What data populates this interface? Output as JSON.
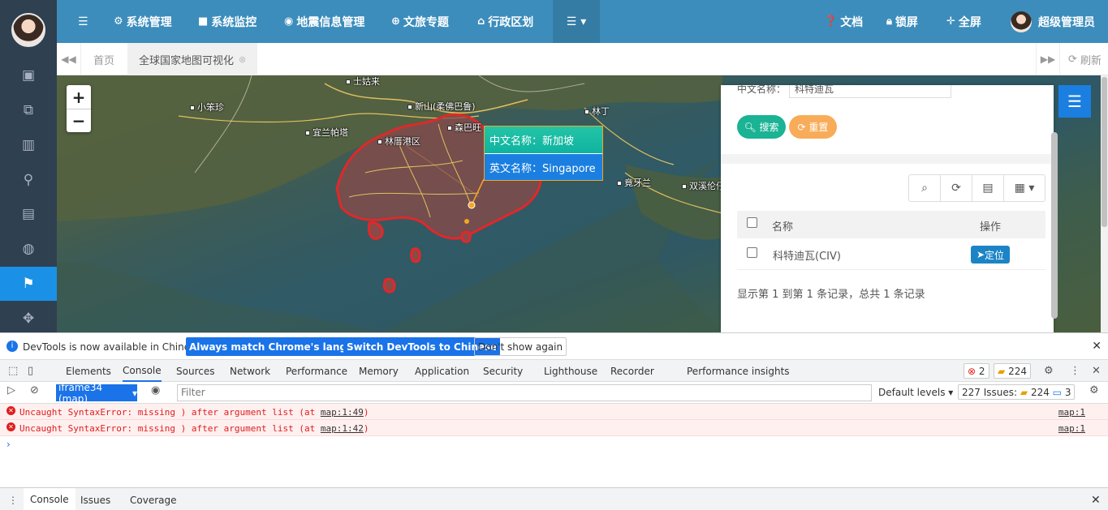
{
  "top_nav": {
    "system_manage": "系统管理",
    "system_monitor": "系统监控",
    "gis_manage": "地震信息管理",
    "culture": "文旅专题",
    "admin_region": "行政区划",
    "docs": "文档",
    "lock": "锁屏",
    "fullscreen": "全屏",
    "user": "超级管理员"
  },
  "tabs": {
    "home": "首页",
    "active": "全球国家地图可视化",
    "refresh": "刷新"
  },
  "map": {
    "places": [
      "士姑来",
      "小笨珍",
      "新山(柔佛巴鲁)",
      "林丁",
      "宜兰帕塔",
      "森巴旺",
      "林厝港区",
      "竟牙兰",
      "双溪伦仔"
    ],
    "popup": {
      "cn": "中文名称：新加坡",
      "en": "英文名称：Singapore"
    }
  },
  "search_panel": {
    "field_label": "中文名称：",
    "field_value": "科特迪瓦",
    "search_btn": "搜索",
    "reset_btn": "重置",
    "columns": [
      "名称",
      "操作"
    ],
    "rows": [
      {
        "name": "科特迪瓦(CIV)",
        "action": "定位"
      }
    ],
    "pagination": "显示第 1 到第 1 条记录，总共 1 条记录"
  },
  "devtools": {
    "info": "DevTools is now available in Chinese!",
    "btn_match": "Always match Chrome's language",
    "btn_switch": "Switch DevTools to Chinese",
    "btn_dismiss": "Don't show again",
    "tabs": [
      "Elements",
      "Console",
      "Sources",
      "Network",
      "Performance",
      "Memory",
      "Application",
      "Security",
      "Lighthouse",
      "Recorder",
      "Performance insights"
    ],
    "error_count": "2",
    "warning_count": "224",
    "context": "iframe34 (map)",
    "filter_placeholder": "Filter",
    "levels": "Default levels",
    "issues_label": "227 Issues:",
    "issues_warn": "224",
    "issues_info": "3",
    "errors": [
      {
        "msg": "Uncaught SyntaxError: missing ) after argument list (at ",
        "loc": "map:1:49",
        "src": "map:1"
      },
      {
        "msg": "Uncaught SyntaxError: missing ) after argument list (at ",
        "loc": "map:1:42",
        "src": "map:1"
      }
    ],
    "drawer_tabs": [
      "Console",
      "Issues",
      "Coverage"
    ]
  },
  "colors": {
    "sidebar": "#2f4050",
    "topnav": "#3c8dbc",
    "accent": "#1a91e6",
    "search": "#1ab394",
    "reset": "#f8ac59"
  }
}
